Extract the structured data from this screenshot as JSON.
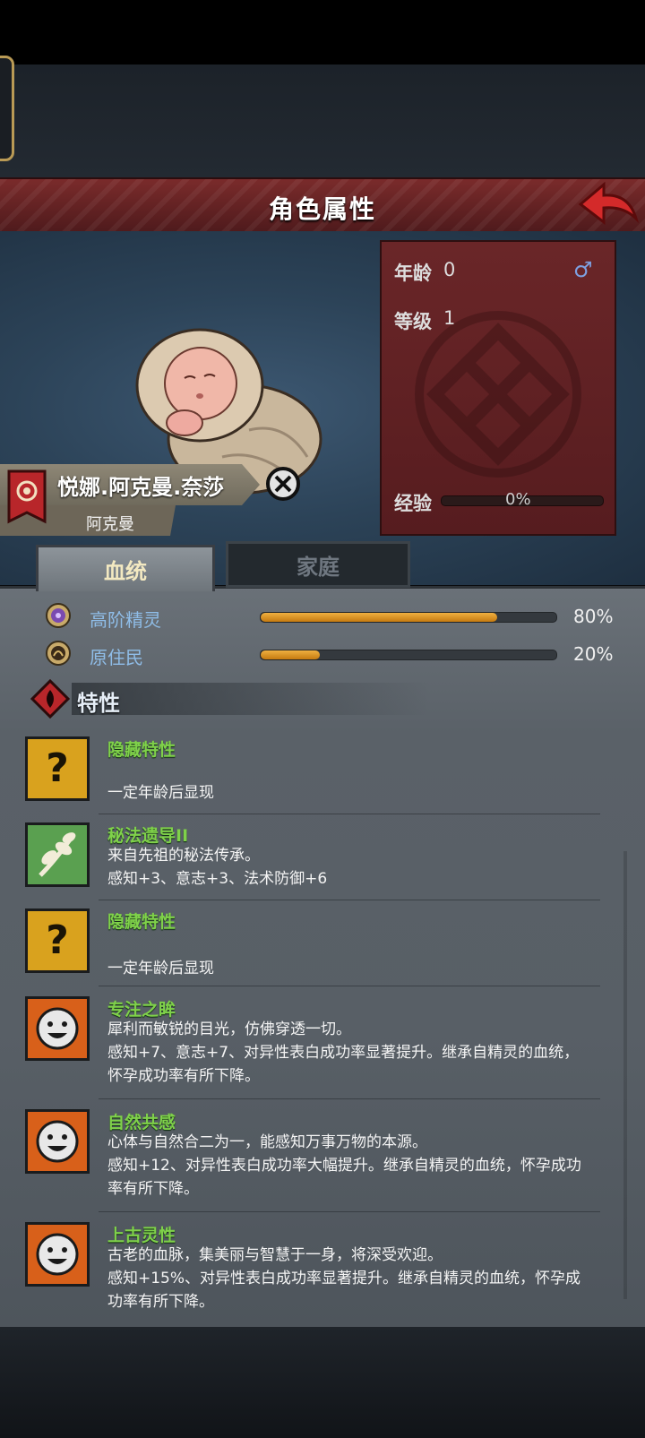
{
  "header": {
    "title": "角色属性",
    "back_icon": "red-arrow-icon"
  },
  "character": {
    "name": "悦娜.阿克曼.奈莎",
    "family": "阿克曼",
    "age_label": "年龄",
    "age_value": "0",
    "gender_symbol": "♂",
    "level_label": "等级",
    "level_value": "1",
    "exp_label": "经验",
    "exp_value": "0%",
    "exp_progress": 0
  },
  "tabs": [
    {
      "label": "血统",
      "active": true
    },
    {
      "label": "家庭",
      "active": false
    }
  ],
  "bloodlines": [
    {
      "name": "高阶精灵",
      "percent": "80%",
      "fraction": 0.8,
      "icon": "high-elf-icon"
    },
    {
      "name": "原住民",
      "percent": "20%",
      "fraction": 0.2,
      "icon": "native-icon"
    }
  ],
  "traits_section": {
    "title": "特性"
  },
  "traits": [
    {
      "name": "隐藏特性",
      "lines": [
        "",
        "一定年龄后显现"
      ],
      "icon": "question-icon"
    },
    {
      "name": "秘法遗导II",
      "lines": [
        "来自先祖的秘法传承。",
        "感知+3、意志+3、法术防御+6"
      ],
      "icon": "leaf-branch-icon"
    },
    {
      "name": "隐藏特性",
      "lines": [
        "",
        "一定年龄后显现"
      ],
      "icon": "question-icon"
    },
    {
      "name": "专注之眸",
      "lines": [
        "犀利而敏锐的目光，仿佛穿透一切。",
        "感知+7、意志+7、对异性表白成功率显著提升。继承自精灵的血统，",
        "怀孕成功率有所下降。"
      ],
      "icon": "smiley-sun-icon"
    },
    {
      "name": "自然共感",
      "lines": [
        "心体与自然合二为一，能感知万事万物的本源。",
        "感知+12、对异性表白成功率大幅提升。继承自精灵的血统，怀孕成功",
        "率有所下降。"
      ],
      "icon": "smiley-sun-icon"
    },
    {
      "name": "上古灵性",
      "lines": [
        "古老的血脉，集美丽与智慧于一身，将深受欢迎。",
        "感知+15%、对异性表白成功率显著提升。继承自精灵的血统，怀孕成",
        "功率有所下降。"
      ],
      "icon": "smiley-sun-icon"
    }
  ]
}
